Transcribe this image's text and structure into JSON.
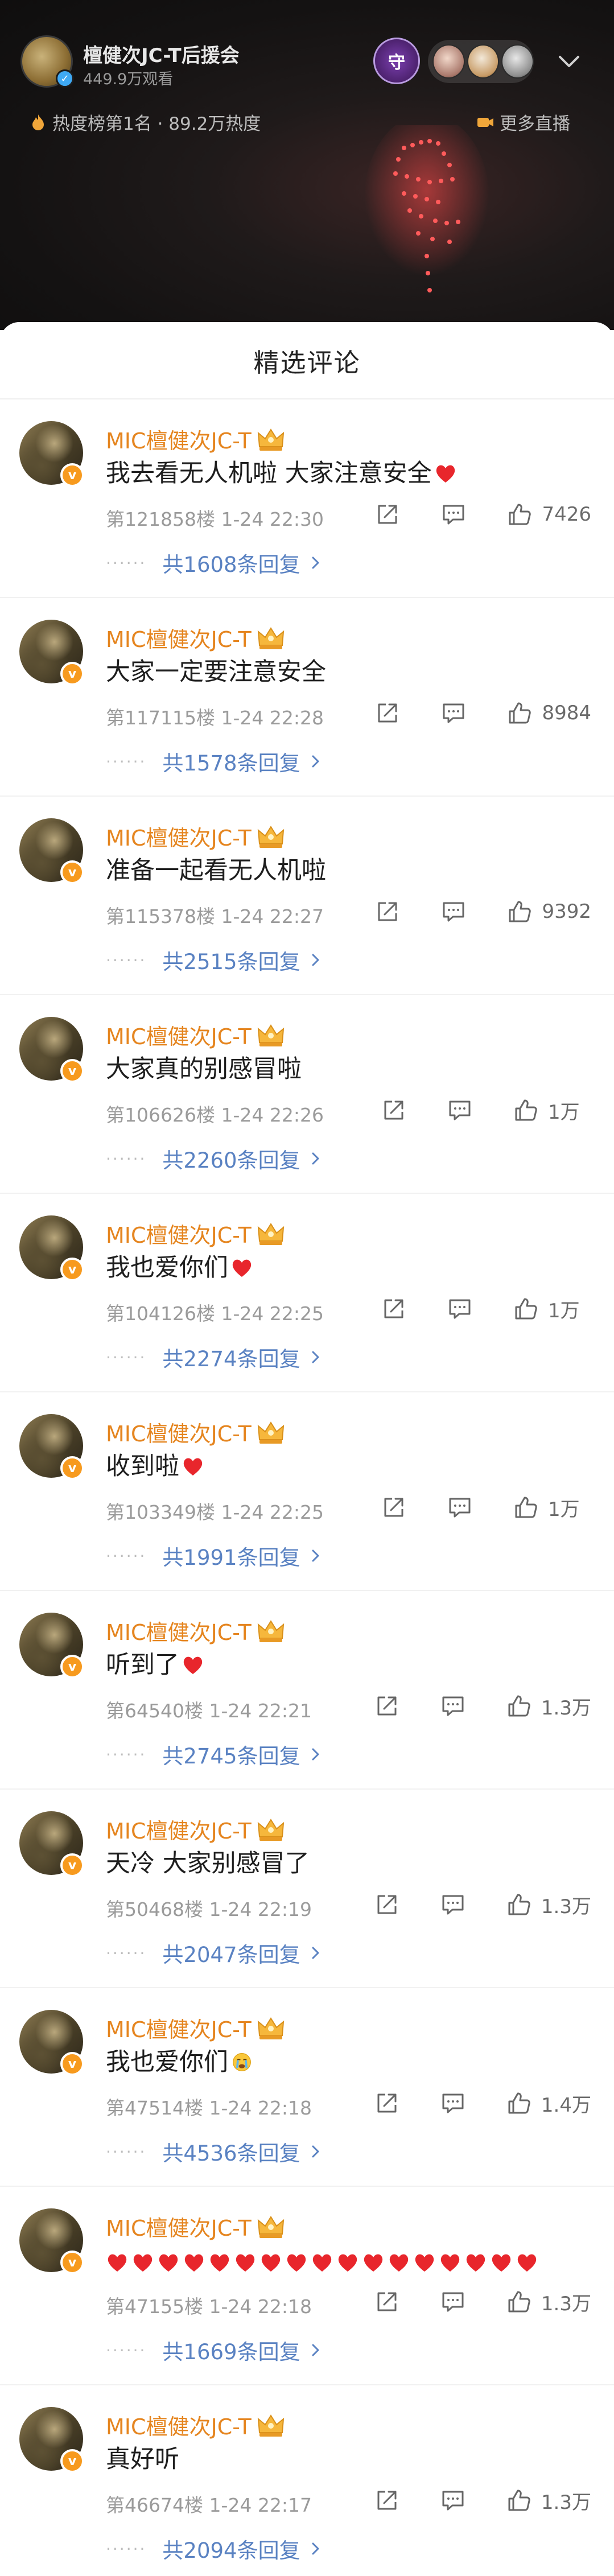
{
  "live": {
    "host_name": "檀健次JC-T后援会",
    "viewers": "449.9万观看",
    "guard_badge": "守",
    "heat_rank": "热度榜第1名 · 89.2万热度",
    "more_live": "更多直播",
    "heat_icon": "flame-icon",
    "more_icon": "video-icon"
  },
  "sheet": {
    "title": "精选评论"
  },
  "colors": {
    "name": "#e5851f",
    "reply_link": "#5a82c2",
    "heart": "#e8262c",
    "verify_badge": "#f79a1e"
  },
  "comments": [
    {
      "name": "MIC檀健次JC-T",
      "text": "我去看无人机啦 大家注意安全",
      "hearts": 1,
      "emoji": "",
      "floor": "第121858楼",
      "time": "1-24 22:30",
      "likes": "7426",
      "replies": "共1608条回复"
    },
    {
      "name": "MIC檀健次JC-T",
      "text": "大家一定要注意安全",
      "hearts": 0,
      "emoji": "",
      "floor": "第117115楼",
      "time": "1-24 22:28",
      "likes": "8984",
      "replies": "共1578条回复"
    },
    {
      "name": "MIC檀健次JC-T",
      "text": "准备一起看无人机啦",
      "hearts": 0,
      "emoji": "",
      "floor": "第115378楼",
      "time": "1-24 22:27",
      "likes": "9392",
      "replies": "共2515条回复"
    },
    {
      "name": "MIC檀健次JC-T",
      "text": "大家真的别感冒啦",
      "hearts": 0,
      "emoji": "",
      "floor": "第106626楼",
      "time": "1-24 22:26",
      "likes": "1万",
      "replies": "共2260条回复"
    },
    {
      "name": "MIC檀健次JC-T",
      "text": "我也爱你们",
      "hearts": 1,
      "emoji": "",
      "floor": "第104126楼",
      "time": "1-24 22:25",
      "likes": "1万",
      "replies": "共2274条回复"
    },
    {
      "name": "MIC檀健次JC-T",
      "text": "收到啦",
      "hearts": 1,
      "emoji": "",
      "floor": "第103349楼",
      "time": "1-24 22:25",
      "likes": "1万",
      "replies": "共1991条回复"
    },
    {
      "name": "MIC檀健次JC-T",
      "text": "听到了",
      "hearts": 1,
      "emoji": "",
      "floor": "第64540楼",
      "time": "1-24 22:21",
      "likes": "1.3万",
      "replies": "共2745条回复"
    },
    {
      "name": "MIC檀健次JC-T",
      "text": "天冷 大家别感冒了",
      "hearts": 0,
      "emoji": "",
      "floor": "第50468楼",
      "time": "1-24 22:19",
      "likes": "1.3万",
      "replies": "共2047条回复"
    },
    {
      "name": "MIC檀健次JC-T",
      "text": "我也爱你们",
      "hearts": 0,
      "emoji": "crying-face",
      "floor": "第47514楼",
      "time": "1-24 22:18",
      "likes": "1.4万",
      "replies": "共4536条回复"
    },
    {
      "name": "MIC檀健次JC-T",
      "text": "",
      "hearts": 17,
      "emoji": "",
      "floor": "第47155楼",
      "time": "1-24 22:18",
      "likes": "1.3万",
      "replies": "共1669条回复"
    },
    {
      "name": "MIC檀健次JC-T",
      "text": "真好听",
      "hearts": 0,
      "emoji": "",
      "floor": "第46674楼",
      "time": "1-24 22:17",
      "likes": "1.3万",
      "replies": "共2094条回复"
    }
  ]
}
